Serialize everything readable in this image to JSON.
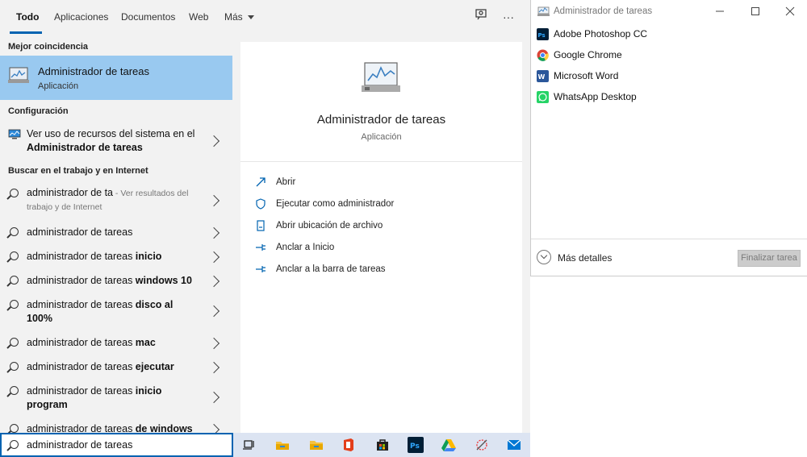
{
  "search": {
    "tabs": [
      {
        "label": "Todo"
      },
      {
        "label": "Aplicaciones"
      },
      {
        "label": "Documentos"
      },
      {
        "label": "Web"
      },
      {
        "label": "Más"
      }
    ],
    "best_match": {
      "section": "Mejor coincidencia",
      "title": "Administrador de tareas",
      "subtitle": "Aplicación"
    },
    "config": {
      "section": "Configuración",
      "line1": "Ver uso de recursos del sistema en el",
      "line2": "Administrador de tareas"
    },
    "web": {
      "section": "Buscar en el trabajo y en Internet",
      "first": {
        "query": "administrador de ta",
        "suffix": " - Ver resultados del",
        "suffix2": "trabajo y de Internet"
      },
      "suggestions": [
        {
          "base": "administrador de tareas",
          "rest": ""
        },
        {
          "base": "administrador de tareas ",
          "rest": "inicio"
        },
        {
          "base": "administrador de tareas ",
          "rest": "windows 10"
        },
        {
          "base": "administrador de tareas ",
          "rest": "disco al",
          "rest2": "100%"
        },
        {
          "base": "administrador de tareas ",
          "rest": "mac"
        },
        {
          "base": "administrador de tareas ",
          "rest": "ejecutar"
        },
        {
          "base": "administrador de tareas ",
          "rest": "inicio",
          "rest2": "program"
        },
        {
          "base": "administrador de tareas ",
          "rest": "de windows"
        }
      ]
    },
    "input_value": "administrador de tareas",
    "detail": {
      "title": "Administrador de tareas",
      "subtitle": "Aplicación",
      "actions": [
        {
          "label": "Abrir",
          "icon": "open-icon"
        },
        {
          "label": "Ejecutar como administrador",
          "icon": "shield-icon"
        },
        {
          "label": "Abrir ubicación de archivo",
          "icon": "file-location-icon"
        },
        {
          "label": "Anclar a Inicio",
          "icon": "pin-icon"
        },
        {
          "label": "Anclar a la barra de tareas",
          "icon": "pin-icon"
        }
      ]
    }
  },
  "task_manager": {
    "title": "Administrador de tareas",
    "apps": [
      {
        "name": "Adobe Photoshop CC",
        "color": "#001e36"
      },
      {
        "name": "Google Chrome",
        "color": "#4285f4"
      },
      {
        "name": "Microsoft Word",
        "color": "#2b579a"
      },
      {
        "name": "WhatsApp Desktop",
        "color": "#25d366"
      }
    ],
    "more_details": "Más detalles",
    "end_task": "Finalizar tarea"
  },
  "taskbar": {
    "icons": [
      "task-view-icon",
      "file-explorer-icon",
      "folder-icon",
      "office-icon",
      "store-icon",
      "photoshop-icon",
      "google-drive-icon",
      "snipping-tool-icon",
      "mail-icon"
    ]
  }
}
